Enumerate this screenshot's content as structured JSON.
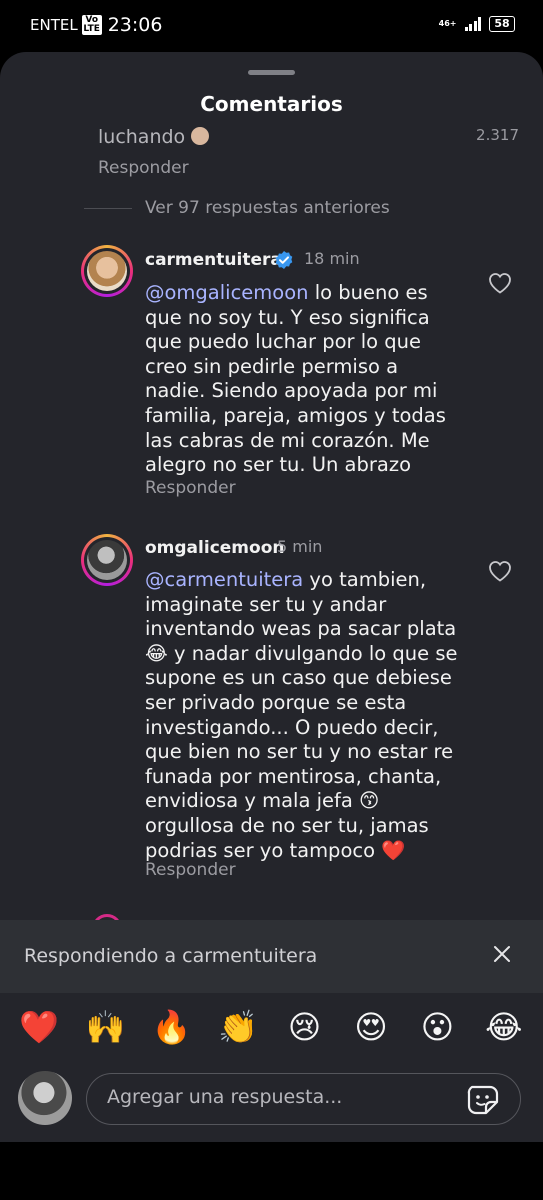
{
  "status_bar": {
    "carrier": "ENTEL",
    "volte_top": "Vo",
    "volte_bottom": "LTE",
    "time": "23:06",
    "network": "46+",
    "battery": "58"
  },
  "sheet": {
    "title": "Comentarios"
  },
  "previous_comment": {
    "text": "luchando",
    "time": "2.317",
    "reply_label": "Responder"
  },
  "view_more": "Ver 97 respuestas anteriores",
  "comments": [
    {
      "username": "carmentuitera",
      "verified": true,
      "time": "18 min",
      "mention": "@omgalicemoon",
      "text": " lo bueno es\nque no soy tu. Y eso significa\nque puedo luchar por lo que\ncreo sin pedirle permiso a\nnadie. Siendo apoyada por mi\nfamilia, pareja, amigos y todas\nlas cabras de mi corazón. Me\nalegro no ser tu. Un abrazo",
      "reply_label": "Responder"
    },
    {
      "username": "omgalicemoon",
      "verified": false,
      "time": "5 min",
      "mention": "@carmentuitera",
      "text": " yo tambien,\nimaginate ser tu y andar\ninventando weas pa sacar plata\n😂 y nadar divulgando lo que se\nsupone es un caso que debiese\nser privado porque se esta\ninvestigando... O puedo decir,\nque bien no ser tu y no estar re\nfunada por mentirosa, chanta,\nenvidiosa y mala jefa 😙\norgullosa de no ser tu, jamas\npodrias ser yo tampoco ❤️",
      "reply_label": "Responder"
    }
  ],
  "reply_bar": {
    "text": "Respondiendo a carmentuitera"
  },
  "reactions": [
    "❤️",
    "🙌",
    "🔥",
    "👏",
    "😢",
    "😍",
    "😮",
    "😂"
  ],
  "composer": {
    "placeholder": "Agregar una respuesta..."
  }
}
